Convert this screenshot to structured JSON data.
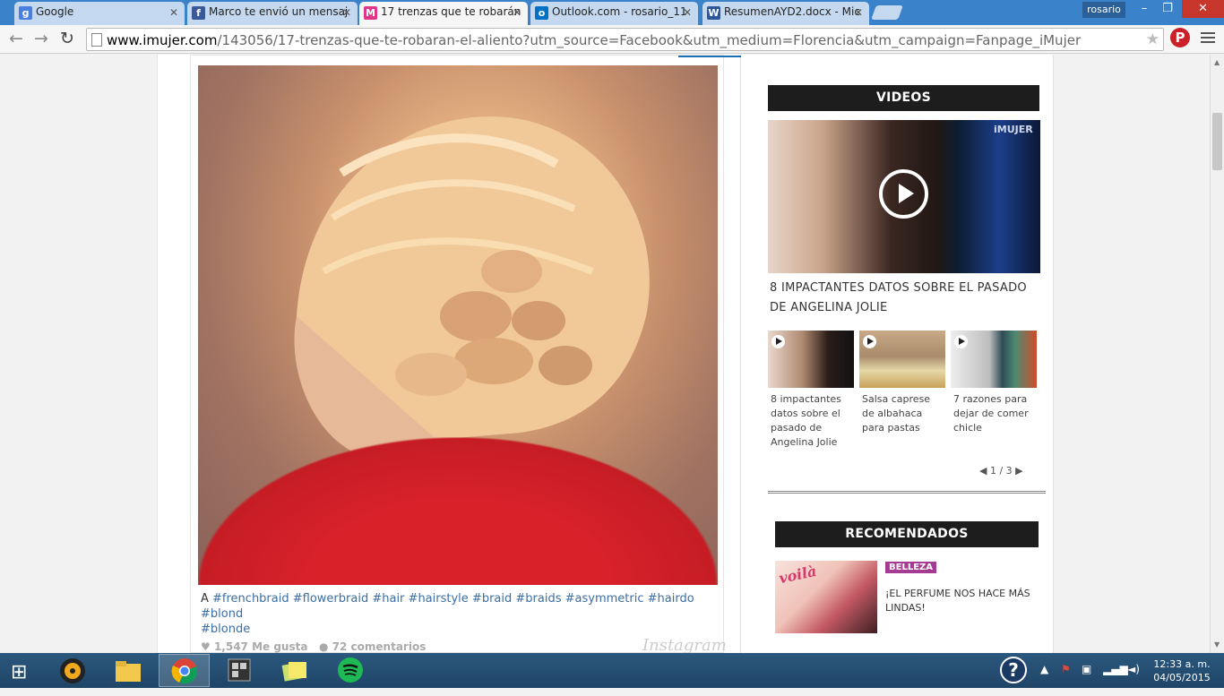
{
  "browser": {
    "tabs": [
      {
        "title": "Google",
        "icon": "google-icon",
        "active": false
      },
      {
        "title": "Marco te envió un mensaj",
        "icon": "facebook-icon",
        "active": false
      },
      {
        "title": "17 trenzas que te robarán",
        "icon": "imujer-icon",
        "active": true
      },
      {
        "title": "Outlook.com - rosario_11",
        "icon": "outlook-icon",
        "active": false
      },
      {
        "title": "ResumenAYD2.docx - Mic",
        "icon": "word-icon",
        "active": false
      }
    ],
    "user": "rosario",
    "url_domain": "www.imujer.com",
    "url_path": "/143056/17-trenzas-que-te-robaran-el-aliento?utm_source=Facebook&utm_medium=Florencia&utm_campaign=Fanpage_iMujer"
  },
  "post": {
    "caption_prefix": "A ",
    "hashtags": [
      "#frenchbraid",
      "#flowerbraid",
      "#hair",
      "#hairstyle",
      "#braid",
      "#braids",
      "#asymmetric",
      "#hairdo",
      "#blond",
      "#blonde"
    ],
    "likes": "1,547 Me gusta",
    "comments": "72 comentarios",
    "watermark": "Instagram"
  },
  "videos": {
    "heading": "VIDEOS",
    "featured_title": "8 IMPACTANTES DATOS SOBRE EL PASADO DE ANGELINA JOLIE",
    "featured_tag": "iMUJER",
    "items": [
      {
        "title": "8 impactantes datos sobre el pasado de Angelina Jolie"
      },
      {
        "title": "Salsa caprese de albahaca para pastas"
      },
      {
        "title": "7 razones para dejar de comer chicle"
      }
    ],
    "pager": "1 / 3"
  },
  "recommended": {
    "heading": "RECOMENDADOS",
    "image_text": "voilà",
    "badge": "BELLEZA",
    "title": "¡EL PERFUME NOS HACE MÁS LINDAS!"
  },
  "taskbar": {
    "clock_time": "12:33 a. m.",
    "clock_date": "04/05/2015",
    "help": "?"
  },
  "colors": {
    "tab_strip": "#3a82c9",
    "section_header": "#1d1d1d",
    "hashtag_link": "#3b6ea5",
    "badge": "#a63b93",
    "taskbar": "#1f4566"
  }
}
